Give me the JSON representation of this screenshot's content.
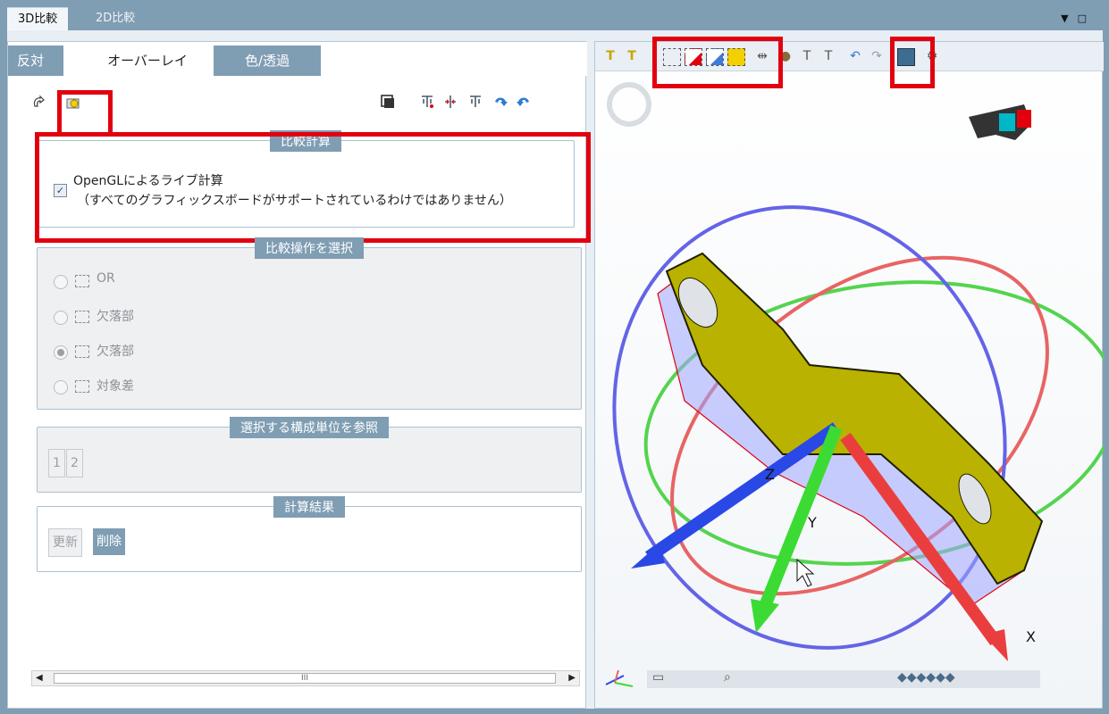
{
  "tabs": {
    "tab_3d": "3D比較",
    "tab_2d": "2D比較"
  },
  "window_controls": {
    "dropdown": "▼",
    "maximize": "□"
  },
  "subtabs": {
    "opposite": "反対",
    "overlay": "オーバーレイ",
    "color": "色/透過"
  },
  "left_toolbar_icons": [
    "rotate-icon",
    "overlay-icon",
    "layer-icon",
    "tree-icon",
    "split-icon",
    "filter-icon",
    "undo-icon",
    "redo-icon"
  ],
  "compare_calc": {
    "title": "比較計算",
    "checkbox_checked": true,
    "line1": "OpenGLによるライブ計算",
    "line2": "（すべてのグラフィックスボードがサポートされているわけではありません）"
  },
  "compare_op": {
    "title": "比較操作を選択",
    "options": [
      {
        "label": "OR",
        "selected": false
      },
      {
        "label": "欠落部",
        "selected": false
      },
      {
        "label": "欠落部",
        "selected": true
      },
      {
        "label": "対象差",
        "selected": false
      }
    ]
  },
  "components": {
    "title": "選択する構成単位を参照",
    "buttons": [
      "1",
      "2"
    ]
  },
  "result": {
    "title": "計算結果",
    "update": "更新",
    "delete": "削除"
  },
  "scrollbar": {
    "grip": "III"
  },
  "axis_labels": {
    "x": "X",
    "y": "Y",
    "z": "Z"
  },
  "colors": {
    "accent": "#7f9db3",
    "highlight": "#e2000f",
    "part": "#b9b200"
  }
}
